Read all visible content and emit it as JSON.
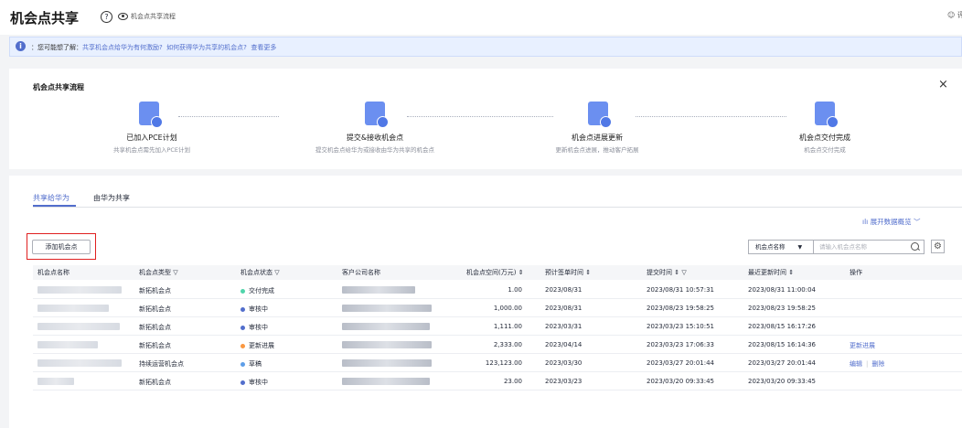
{
  "header": {
    "title": "机会点共享",
    "help_icon": "?",
    "flow_link": "机会点共享流程",
    "eval": "评价"
  },
  "notice": {
    "prefix": "：您可能想了解：",
    "link1": "共享机会点给华为有何激励?",
    "link2": "如何获得华为共享的机会点?",
    "link3": "查看更多"
  },
  "flow": {
    "title": "机会点共享流程",
    "close": "×",
    "steps": [
      {
        "title": "已加入PCE计划",
        "desc": "共享机会点需先加入PCE计划"
      },
      {
        "title": "提交&接收机会点",
        "desc": "提交机会点给华为或接收由华为共享的机会点"
      },
      {
        "title": "机会点进展更新",
        "desc": "更新机会点进展，推动客户拓展"
      },
      {
        "title": "机会点交付完成",
        "desc": "机会点交付完成"
      }
    ]
  },
  "tabs": [
    "共享给华为",
    "由华为共享"
  ],
  "toolbar": {
    "expand": "展开数据概览",
    "add_button": "添加机会点",
    "filter_field": "机会点名称",
    "search_placeholder": "请输入机会点名称"
  },
  "table": {
    "columns": [
      "机会点名称",
      "机会点类型",
      "机会点状态",
      "客户公司名称",
      "机会点空间(万元)",
      "预计签单时间",
      "提交时间",
      "最近更新时间",
      "操作"
    ],
    "rows": [
      {
        "type": "新拓机会点",
        "status": "交付完成",
        "status_color": "#50d4ab",
        "amount": "1.00",
        "sign": "2023/08/31",
        "submit": "2023/08/31 10:57:31",
        "updated": "2023/08/31 11:00:04",
        "ops": []
      },
      {
        "type": "新拓机会点",
        "status": "审核中",
        "status_color": "#526ecc",
        "amount": "1,000.00",
        "sign": "2023/08/31",
        "submit": "2023/08/23 19:58:25",
        "updated": "2023/08/23 19:58:25",
        "ops": []
      },
      {
        "type": "新拓机会点",
        "status": "审核中",
        "status_color": "#526ecc",
        "amount": "1,111.00",
        "sign": "2023/03/31",
        "submit": "2023/03/23 15:10:51",
        "updated": "2023/08/15 16:17:26",
        "ops": []
      },
      {
        "type": "新拓机会点",
        "status": "更新进展",
        "status_color": "#fa9841",
        "amount": "2,333.00",
        "sign": "2023/04/14",
        "submit": "2023/03/23 17:06:33",
        "updated": "2023/08/15 16:14:36",
        "ops": [
          "更新进展"
        ]
      },
      {
        "type": "持续运营机会点",
        "status": "草稿",
        "status_color": "#5e9ee8",
        "amount": "123,123.00",
        "sign": "2023/03/30",
        "submit": "2023/03/27 20:01:44",
        "updated": "2023/03/27 20:01:44",
        "ops": [
          "编辑",
          "删除"
        ]
      },
      {
        "type": "新拓机会点",
        "status": "审核中",
        "status_color": "#526ecc",
        "amount": "23.00",
        "sign": "2023/03/23",
        "submit": "2023/03/20 09:33:45",
        "updated": "2023/03/20 09:33:45",
        "ops": []
      }
    ]
  }
}
